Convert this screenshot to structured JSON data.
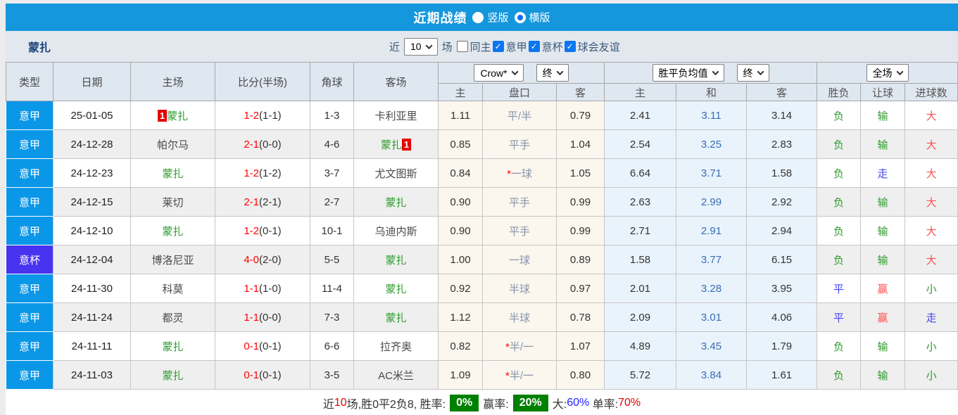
{
  "title_bar": {
    "title": "近期战绩",
    "options": [
      {
        "label": "竖版",
        "selected": false
      },
      {
        "label": "横版",
        "selected": true
      }
    ]
  },
  "filter": {
    "team": "蒙扎",
    "near": "近",
    "count": "10",
    "games": "场",
    "checkboxes": [
      {
        "label": "同主",
        "checked": false
      },
      {
        "label": "意甲",
        "checked": true
      },
      {
        "label": "意杯",
        "checked": true
      },
      {
        "label": "球会友谊",
        "checked": true
      }
    ]
  },
  "table": {
    "col_headers": [
      "类型",
      "日期",
      "主场",
      "比分(半场)",
      "角球",
      "客场"
    ],
    "sub_headers": [
      "主",
      "盘口",
      "客",
      "主",
      "和",
      "客",
      "胜负",
      "让球",
      "进球数"
    ],
    "selects": {
      "bookmaker": "Crow*",
      "bookmaker_time": "终",
      "average": "胜平负均值",
      "average_time": "终",
      "scope": "全场"
    },
    "rows": [
      {
        "league": "意甲",
        "cup": false,
        "date": "25-01-05",
        "home": "蒙扎",
        "home_green": true,
        "home_badge": true,
        "score": "1-2",
        "half": "(1-1)",
        "corners": "1-3",
        "away": "卡利亚里",
        "away_green": false,
        "away_badge": false,
        "o_home": "1.11",
        "h_star": false,
        "handicap": "平/半",
        "o_away": "0.79",
        "avg_home": "2.41",
        "avg_draw": "3.11",
        "avg_away": "3.14",
        "wdl": "负",
        "wdl_c": "green",
        "let": "输",
        "let_c": "green",
        "goal": "大",
        "goal_c": "red"
      },
      {
        "league": "意甲",
        "cup": false,
        "date": "24-12-28",
        "home": "帕尔马",
        "home_green": false,
        "home_badge": false,
        "score": "2-1",
        "half": "(0-0)",
        "corners": "4-6",
        "away": "蒙扎",
        "away_green": true,
        "away_badge": true,
        "o_home": "0.85",
        "h_star": false,
        "handicap": "平手",
        "o_away": "1.04",
        "avg_home": "2.54",
        "avg_draw": "3.25",
        "avg_away": "2.83",
        "wdl": "负",
        "wdl_c": "green",
        "let": "输",
        "let_c": "green",
        "goal": "大",
        "goal_c": "red"
      },
      {
        "league": "意甲",
        "cup": false,
        "date": "24-12-23",
        "home": "蒙扎",
        "home_green": true,
        "home_badge": false,
        "score": "1-2",
        "half": "(1-2)",
        "corners": "3-7",
        "away": "尤文图斯",
        "away_green": false,
        "away_badge": false,
        "o_home": "0.84",
        "h_star": true,
        "handicap": "一球",
        "o_away": "1.05",
        "avg_home": "6.64",
        "avg_draw": "3.71",
        "avg_away": "1.58",
        "wdl": "负",
        "wdl_c": "green",
        "let": "走",
        "let_c": "blue",
        "goal": "大",
        "goal_c": "red"
      },
      {
        "league": "意甲",
        "cup": false,
        "date": "24-12-15",
        "home": "莱切",
        "home_green": false,
        "home_badge": false,
        "score": "2-1",
        "half": "(2-1)",
        "corners": "2-7",
        "away": "蒙扎",
        "away_green": true,
        "away_badge": false,
        "o_home": "0.90",
        "h_star": false,
        "handicap": "平手",
        "o_away": "0.99",
        "avg_home": "2.63",
        "avg_draw": "2.99",
        "avg_away": "2.92",
        "wdl": "负",
        "wdl_c": "green",
        "let": "输",
        "let_c": "green",
        "goal": "大",
        "goal_c": "red"
      },
      {
        "league": "意甲",
        "cup": false,
        "date": "24-12-10",
        "home": "蒙扎",
        "home_green": true,
        "home_badge": false,
        "score": "1-2",
        "half": "(0-1)",
        "corners": "10-1",
        "away": "乌迪内斯",
        "away_green": false,
        "away_badge": false,
        "o_home": "0.90",
        "h_star": false,
        "handicap": "平手",
        "o_away": "0.99",
        "avg_home": "2.71",
        "avg_draw": "2.91",
        "avg_away": "2.94",
        "wdl": "负",
        "wdl_c": "green",
        "let": "输",
        "let_c": "green",
        "goal": "大",
        "goal_c": "red"
      },
      {
        "league": "意杯",
        "cup": true,
        "date": "24-12-04",
        "home": "博洛尼亚",
        "home_green": false,
        "home_badge": false,
        "score": "4-0",
        "half": "(2-0)",
        "corners": "5-5",
        "away": "蒙扎",
        "away_green": true,
        "away_badge": false,
        "o_home": "1.00",
        "h_star": false,
        "handicap": "一球",
        "o_away": "0.89",
        "avg_home": "1.58",
        "avg_draw": "3.77",
        "avg_away": "6.15",
        "wdl": "负",
        "wdl_c": "green",
        "let": "输",
        "let_c": "green",
        "goal": "大",
        "goal_c": "red"
      },
      {
        "league": "意甲",
        "cup": false,
        "date": "24-11-30",
        "home": "科莫",
        "home_green": false,
        "home_badge": false,
        "score": "1-1",
        "half": "(1-0)",
        "corners": "11-4",
        "away": "蒙扎",
        "away_green": true,
        "away_badge": false,
        "o_home": "0.92",
        "h_star": false,
        "handicap": "半球",
        "o_away": "0.97",
        "avg_home": "2.01",
        "avg_draw": "3.28",
        "avg_away": "3.95",
        "wdl": "平",
        "wdl_c": "blue",
        "let": "赢",
        "let_c": "red",
        "goal": "小",
        "goal_c": "green"
      },
      {
        "league": "意甲",
        "cup": false,
        "date": "24-11-24",
        "home": "都灵",
        "home_green": false,
        "home_badge": false,
        "score": "1-1",
        "half": "(0-0)",
        "corners": "7-3",
        "away": "蒙扎",
        "away_green": true,
        "away_badge": false,
        "o_home": "1.12",
        "h_star": false,
        "handicap": "半球",
        "o_away": "0.78",
        "avg_home": "2.09",
        "avg_draw": "3.01",
        "avg_away": "4.06",
        "wdl": "平",
        "wdl_c": "blue",
        "let": "赢",
        "let_c": "red",
        "goal": "走",
        "goal_c": "blue"
      },
      {
        "league": "意甲",
        "cup": false,
        "date": "24-11-11",
        "home": "蒙扎",
        "home_green": true,
        "home_badge": false,
        "score": "0-1",
        "half": "(0-1)",
        "corners": "6-6",
        "away": "拉齐奥",
        "away_green": false,
        "away_badge": false,
        "o_home": "0.82",
        "h_star": true,
        "handicap": "半/一",
        "o_away": "1.07",
        "avg_home": "4.89",
        "avg_draw": "3.45",
        "avg_away": "1.79",
        "wdl": "负",
        "wdl_c": "green",
        "let": "输",
        "let_c": "green",
        "goal": "小",
        "goal_c": "green"
      },
      {
        "league": "意甲",
        "cup": false,
        "date": "24-11-03",
        "home": "蒙扎",
        "home_green": true,
        "home_badge": false,
        "score": "0-1",
        "half": "(0-1)",
        "corners": "3-5",
        "away": "AC米兰",
        "away_green": false,
        "away_badge": false,
        "o_home": "1.09",
        "h_star": true,
        "handicap": "半/一",
        "o_away": "0.80",
        "avg_home": "5.72",
        "avg_draw": "3.84",
        "avg_away": "1.61",
        "wdl": "负",
        "wdl_c": "green",
        "let": "输",
        "let_c": "green",
        "goal": "小",
        "goal_c": "green"
      }
    ]
  },
  "summary": {
    "parts": [
      {
        "text": "近",
        "style": "plain"
      },
      {
        "text": "10",
        "style": "red"
      },
      {
        "text": "场,胜0平2负8, 胜率:",
        "style": "plain"
      },
      {
        "text": "0%",
        "style": "greenbox"
      },
      {
        "text": "赢率:",
        "style": "plain"
      },
      {
        "text": "20%",
        "style": "greenbox"
      },
      {
        "text": "大:",
        "style": "plain"
      },
      {
        "text": "60%",
        "style": "blue"
      },
      {
        "text": " 单率:",
        "style": "plain"
      },
      {
        "text": "70%",
        "style": "red"
      }
    ]
  },
  "colors": {
    "accent_blue": "#1497dc",
    "league_blue": "#0a97e8",
    "cup_blue": "#4733f0",
    "team_green": "#2e9b2e",
    "score_red": "#ff0000",
    "soft_red": "#fb5151",
    "neutral_blue": "#4444f0",
    "avg_draw_blue": "#3a6cb5",
    "summary_green": "#008000"
  }
}
